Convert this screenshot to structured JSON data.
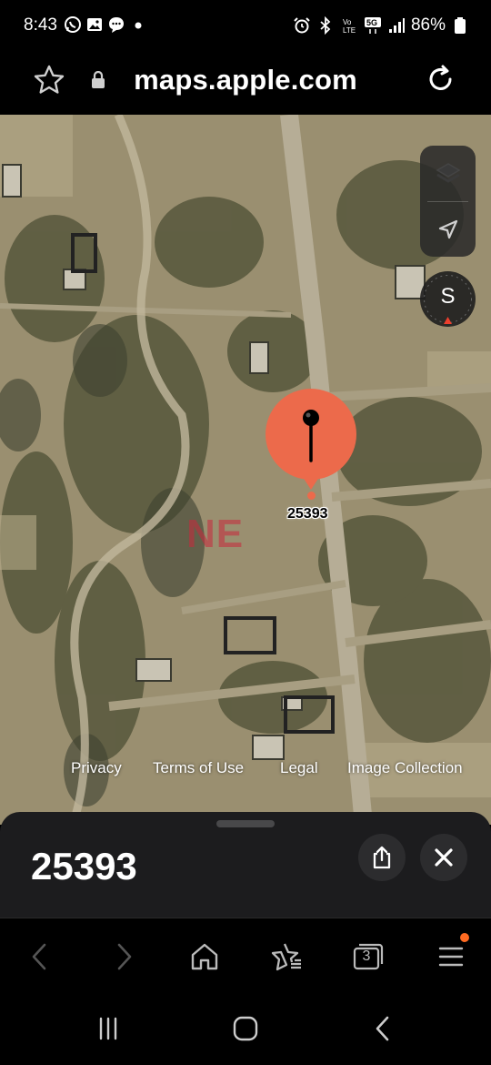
{
  "status_bar": {
    "time": "8:43",
    "left_icons": [
      "whatsapp-icon",
      "gallery-icon",
      "messages-icon",
      "dot-icon"
    ],
    "right_icons": [
      "alarm-icon",
      "bluetooth-icon",
      "volte-icon",
      "5g-icon",
      "signal-icon"
    ],
    "battery": "86%"
  },
  "browser": {
    "url": "maps.apple.com",
    "icons": {
      "bookmark": "star-icon",
      "secure": "lock-icon",
      "reload": "reload-icon"
    }
  },
  "map": {
    "compass_heading": "S",
    "pin_label": "25393",
    "pin_color": "#ec6a4b",
    "watermark": "NE",
    "footer_links": [
      "Privacy",
      "Terms of Use",
      "Legal",
      "Image Collection"
    ],
    "controls": [
      "map-layers-icon",
      "location-arrow-icon"
    ]
  },
  "sheet": {
    "title": "25393",
    "actions": [
      "share-icon",
      "close-icon"
    ]
  },
  "toolbar": {
    "tabs_count": "3",
    "items": [
      "back-icon",
      "forward-icon",
      "home-icon",
      "bookmarks-icon",
      "tabs-icon",
      "menu-icon"
    ],
    "badge_color": "#ff6a21"
  },
  "nav_bar": {
    "items": [
      "recents-icon",
      "home-icon",
      "back-icon"
    ]
  }
}
